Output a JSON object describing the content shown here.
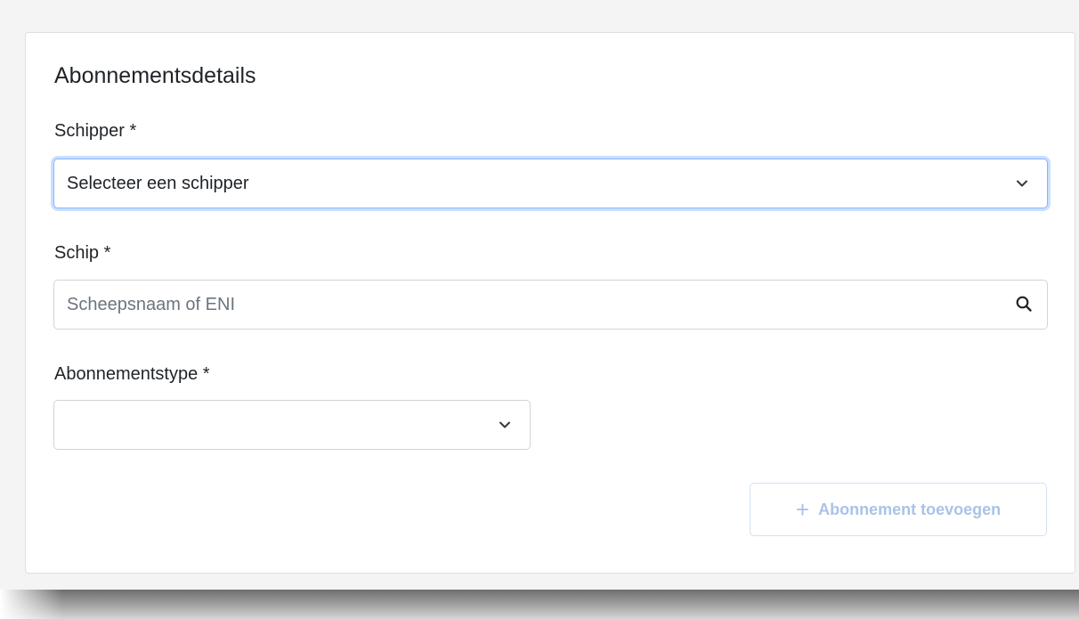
{
  "form": {
    "title": "Abonnementsdetails",
    "skipper": {
      "label": "Schipper *",
      "value": "Selecteer een schipper",
      "icon": "chevron-down-icon"
    },
    "ship": {
      "label": "Schip *",
      "placeholder": "Scheepsnaam of ENI",
      "icon": "search-icon"
    },
    "subscription_type": {
      "label": "Abonnementstype *",
      "value": "",
      "icon": "chevron-down-icon"
    },
    "add_button": {
      "icon": "plus-icon",
      "icon_glyph": "+",
      "label": "Abonnement toevoegen",
      "disabled": true
    }
  },
  "colors": {
    "focus_border": "#86b7fe",
    "button_disabled_text": "#a9c3e8",
    "field_border": "#cfd4da"
  }
}
